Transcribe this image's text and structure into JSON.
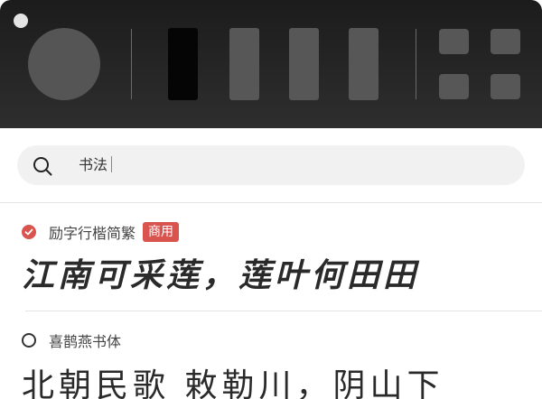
{
  "toolbar": {
    "icons": [
      "window-dot",
      "font-size-circle",
      "weight-bar-active",
      "weight-bar",
      "weight-bar",
      "weight-bar",
      "grid-square",
      "grid-square",
      "grid-square",
      "grid-square"
    ]
  },
  "search": {
    "value": "书法",
    "icon": "search-icon"
  },
  "fonts": [
    {
      "name": "励字行楷简繁",
      "badge": "商用",
      "selected": true,
      "preview": "江南可采莲，莲叶何田田"
    },
    {
      "name": "喜鹊燕书体",
      "badge": "",
      "selected": false,
      "preview": "北朝民歌 敕勒川，阴山下"
    }
  ],
  "colors": {
    "accent": "#d9534f",
    "toolbar_bg": "#1c1c1c",
    "search_bg": "#f1f1f1"
  }
}
